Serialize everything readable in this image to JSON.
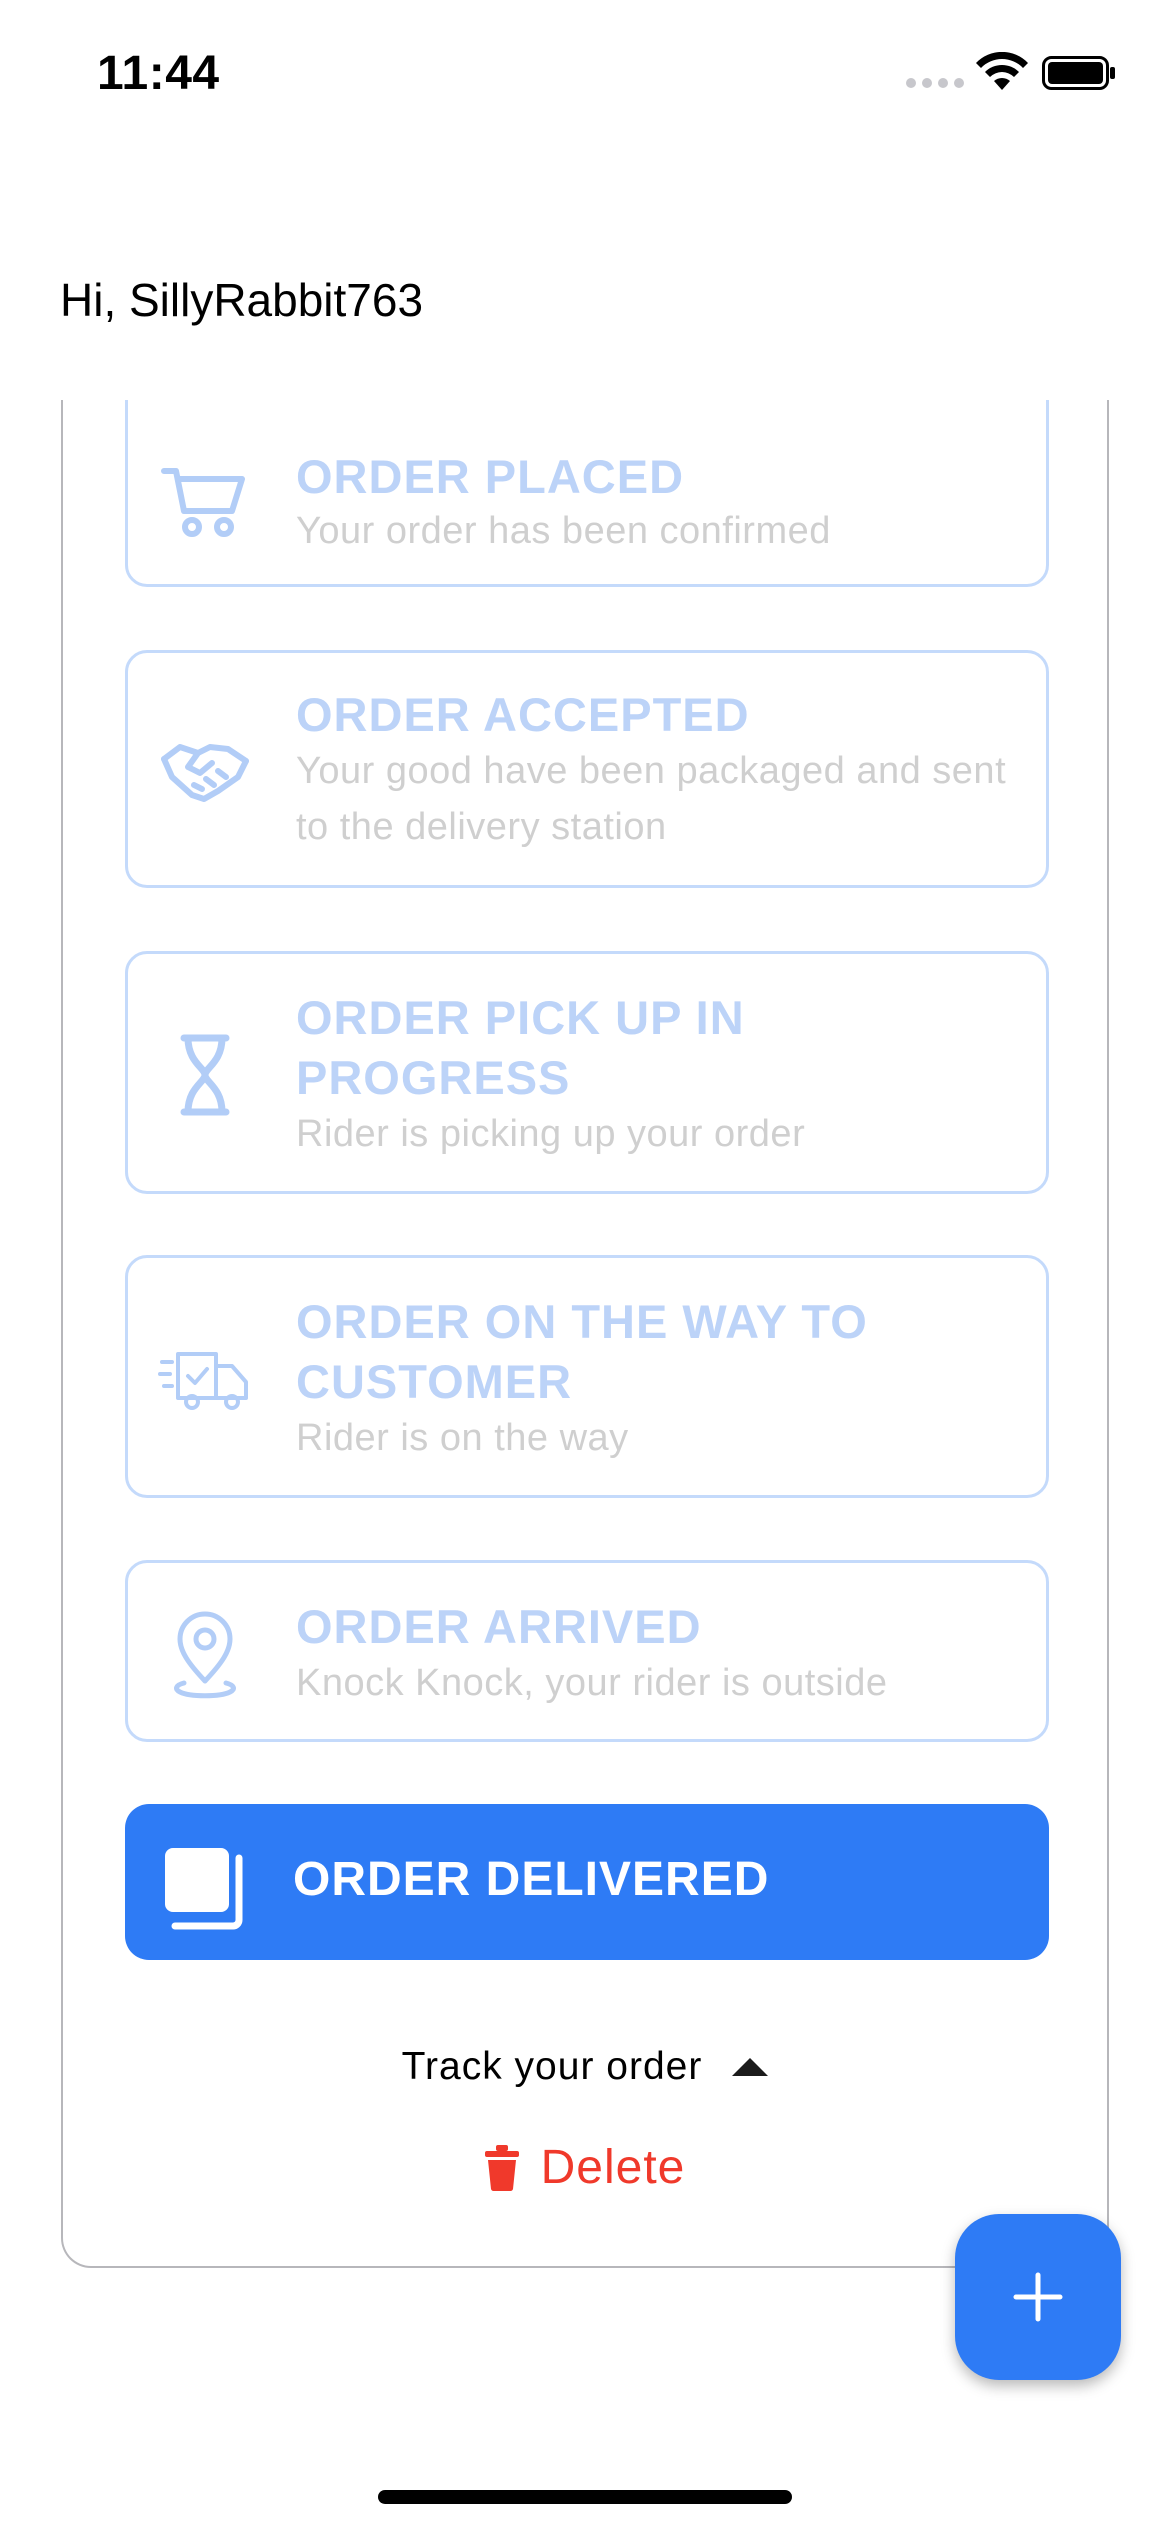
{
  "status_bar": {
    "time": "11:44"
  },
  "header": {
    "greeting": "Hi, SillyRabbit763"
  },
  "steps": [
    {
      "title": "ORDER PLACED",
      "subtitle": "Your order has been confirmed",
      "icon": "cart-icon"
    },
    {
      "title": "ORDER ACCEPTED",
      "subtitle": "Your good have been packaged and sent to the delivery station",
      "icon": "handshake-icon"
    },
    {
      "title": "ORDER PICK UP IN PROGRESS",
      "subtitle": "Rider is picking up your order",
      "icon": "hourglass-icon"
    },
    {
      "title": "ORDER ON THE WAY TO CUSTOMER",
      "subtitle": "Rider is on the way",
      "icon": "delivery-truck-icon"
    },
    {
      "title": "ORDER ARRIVED",
      "subtitle": "Knock Knock, your rider is outside",
      "icon": "location-pin-icon"
    }
  ],
  "active_step": {
    "title": "ORDER DELIVERED",
    "icon": "package-icon"
  },
  "track": {
    "label": "Track your order"
  },
  "delete": {
    "label": "Delete"
  },
  "fab": {
    "label": "+"
  },
  "colors": {
    "accent": "#2e7bf5",
    "inactive_border": "#c4dafb",
    "inactive_title": "#bcd3f8",
    "inactive_subtitle": "#cfcfcf",
    "danger": "#f0392b"
  }
}
